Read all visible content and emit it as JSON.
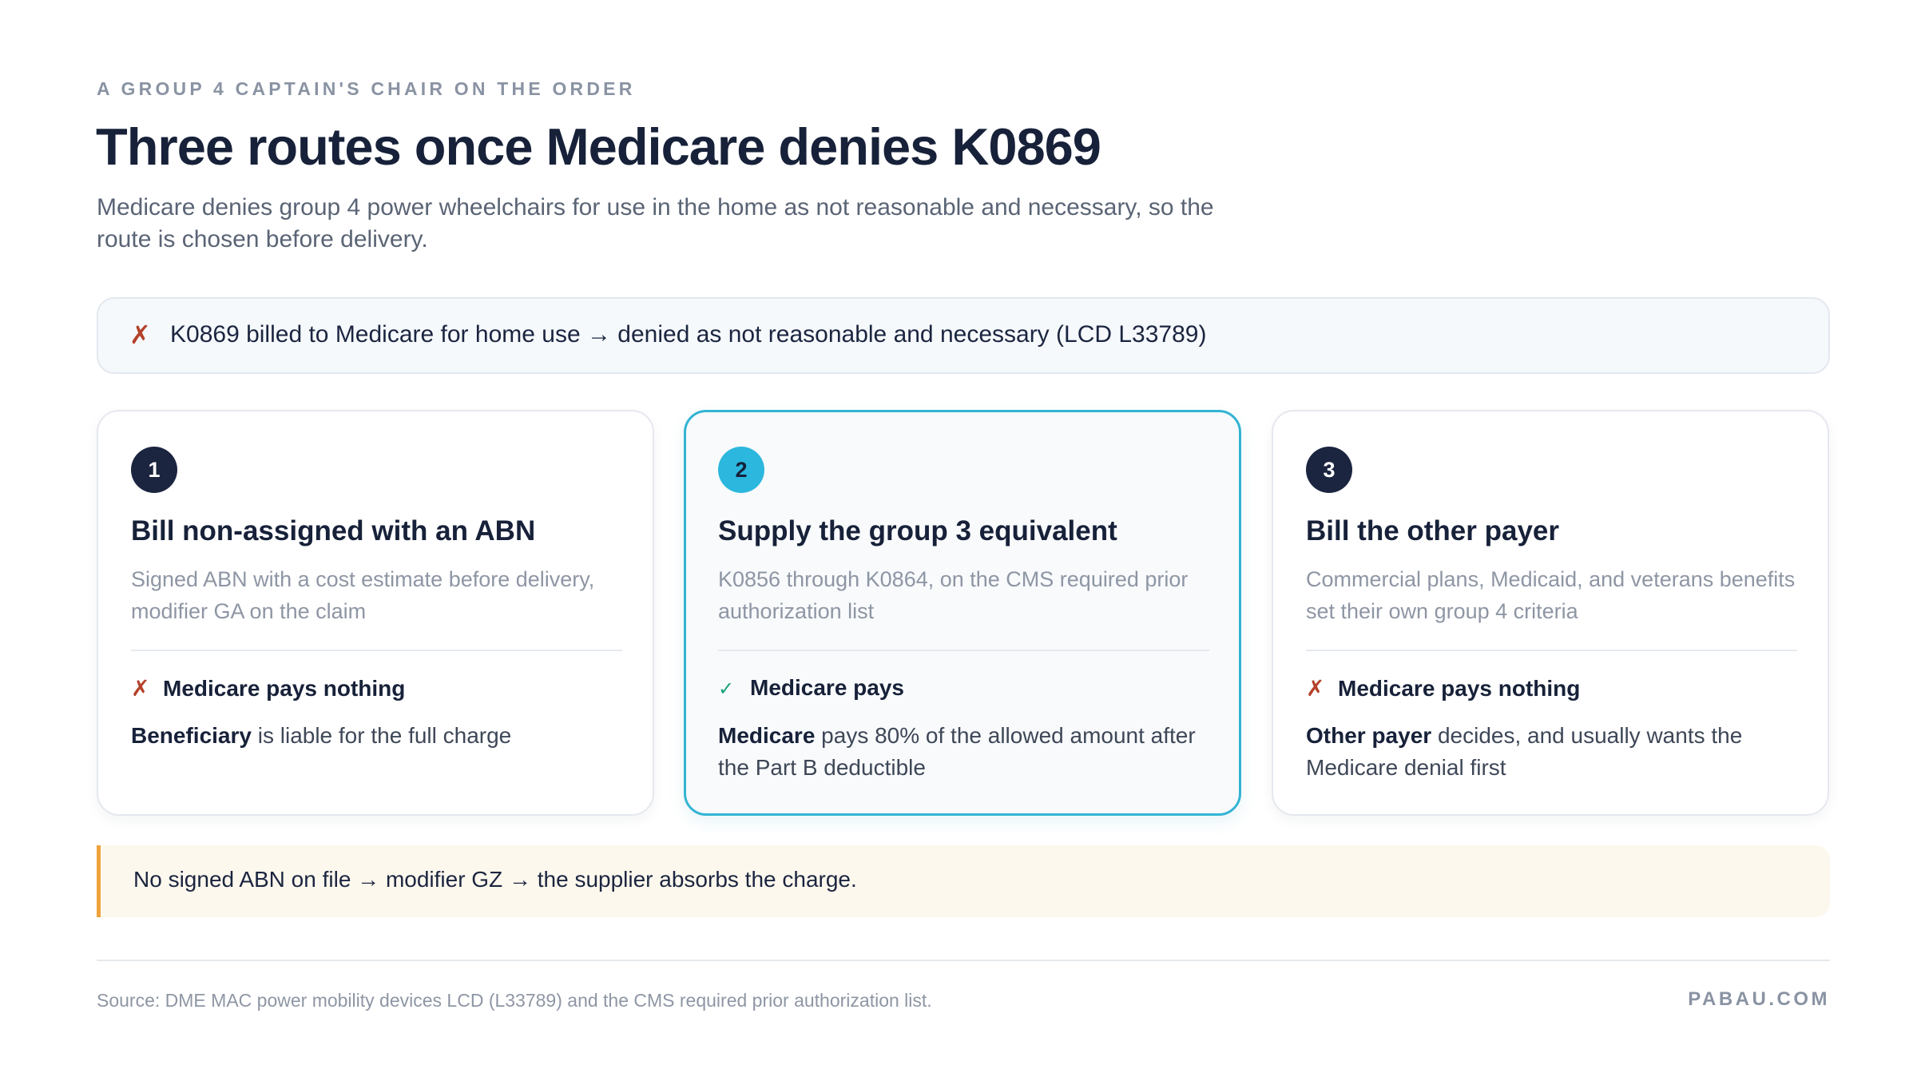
{
  "header": {
    "eyebrow": "A GROUP 4 CAPTAIN'S CHAIR ON THE ORDER",
    "title": "Three routes once Medicare denies K0869",
    "subtitle": "Medicare denies group 4 power wheelchairs for use in the home as not reasonable and necessary, so the route is chosen before delivery."
  },
  "denial": {
    "icon": "cross-mark-icon",
    "text": "K0869 billed to Medicare for home use → denied as not reasonable and necessary (LCD L33789)"
  },
  "routes": [
    {
      "number": "1",
      "title": "Bill non-assigned with an ABN",
      "description": "Signed ABN with a cost estimate before delivery, modifier GA on the claim",
      "verdict_icon": "✗",
      "verdict": "Medicare pays nothing",
      "outcome_bold": "Beneficiary",
      "outcome_rest": " is liable for the full charge"
    },
    {
      "number": "2",
      "title": "Supply the group 3 equivalent",
      "description": "K0856 through K0864, on the CMS required prior authorization list",
      "verdict_icon": "✓",
      "verdict": "Medicare pays",
      "outcome_bold": "Medicare",
      "outcome_rest": " pays 80% of the allowed amount after the Part B deductible",
      "highlighted": true
    },
    {
      "number": "3",
      "title": "Bill the other payer",
      "description": "Commercial plans, Medicaid, and veterans benefits set their own group 4 criteria",
      "verdict_icon": "✗",
      "verdict": "Medicare pays nothing",
      "outcome_bold": "Other payer",
      "outcome_rest": " decides, and usually wants the Medicare denial first"
    }
  ],
  "note": {
    "text": "No signed ABN on file → modifier GZ → the supplier absorbs the charge."
  },
  "footer": {
    "source": "Source: DME MAC power mobility devices LCD (L33789) and the CMS required prior authorization list.",
    "brand": "PABAU.COM"
  },
  "colors": {
    "navy": "#1b2540",
    "accent_cyan": "#2bb7de",
    "deny_red": "#b34129",
    "approve_green": "#1aa17a",
    "note_amber": "#f0a23b"
  }
}
